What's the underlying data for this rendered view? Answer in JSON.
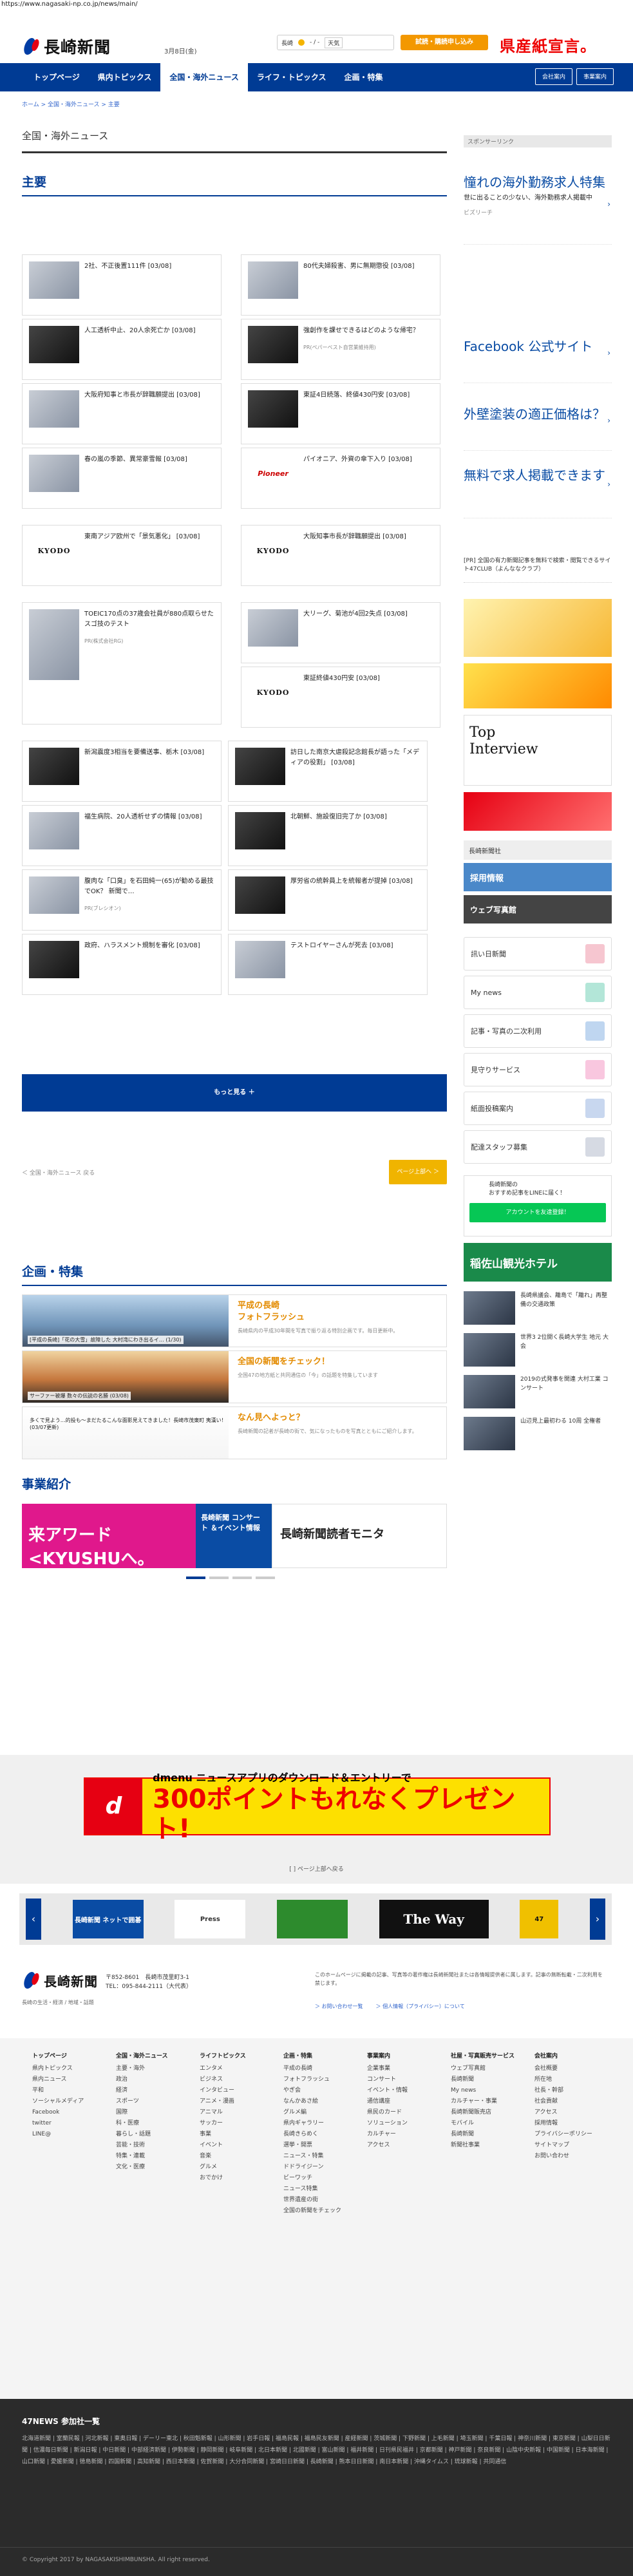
{
  "url": "https://www.nagasaki-np.co.jp/news/main/",
  "header": {
    "logo_text": "長崎新聞",
    "date": "3月8日(金)",
    "weather_label": "長崎",
    "weather_temp": "- / -",
    "weather_link": "天気",
    "trial_button": "試読・購読申し込み",
    "banner_text": "県産紙宣言。"
  },
  "nav": {
    "items": [
      "トップページ",
      "県内トピックス",
      "全国・海外ニュース",
      "ライフ・トピックス",
      "企画・特集"
    ],
    "active_index": 2,
    "right": [
      "会社案内",
      "事業案内"
    ]
  },
  "breadcrumb": "ホーム > 全国・海外ニュース > 主要",
  "page_title": "全国・海外ニュース",
  "section_main": "主要",
  "cards": [
    {
      "text": "2社、不正後置111件 [03/08]",
      "thumb": "light"
    },
    {
      "text": "80代夫婦殺害、男に無期懲役 [03/08]",
      "thumb": "light"
    },
    {
      "text": "人工透析中止、20人余死亡か [03/08]",
      "thumb": "dark"
    },
    {
      "text": "強創作を課せできるはどのような帰宅？",
      "pr": "PR(ペパーベスト自営業維持用)",
      "thumb": "dark"
    },
    {
      "text": "大阪府知事と市長が辞職願提出 [03/08]",
      "thumb": "light"
    },
    {
      "text": "東証4日続落、終値430円安 [03/08]",
      "thumb": "dark"
    },
    {
      "text": "春の嵐の季節、異常豪雪報 [03/08]",
      "thumb": "light"
    },
    {
      "text": "パイオニア、外資の傘下入り [03/08]",
      "thumb": "pioneer",
      "thumb_text": "Pioneer"
    },
    {
      "text": "東南アジア欧州で「景気悪化」 [03/08]",
      "thumb": "kyodo",
      "thumb_text": "KYODO"
    },
    {
      "text": "大阪知事市長が辞職願提出 [03/08]",
      "thumb": "kyodo",
      "thumb_text": "KYODO"
    },
    {
      "text": "TOEIC170点の37歳会社員が880点取らせたスゴ技のテスト",
      "pr": "PR(株式会社RG)",
      "thumb": "light"
    },
    {
      "text": "大リーグ、菊池が4回2失点 [03/08]",
      "thumb": "light"
    },
    {
      "text": "東証終値430円安 [03/08]",
      "thumb": "kyodo",
      "thumb_text": "KYODO"
    },
    {
      "text": "新潟震度3相当を要備送事、栃木 [03/08]",
      "thumb": "dark"
    },
    {
      "text": "訪日した南京大虐殺記念館長が語った「メディアの役割」 [03/08]",
      "thumb": "dark"
    },
    {
      "text": "福生病院、20人透析せずの情報 [03/08]",
      "thumb": "light"
    },
    {
      "text": "北朝鮮、施設復旧完了か [03/08]",
      "thumb": "dark"
    },
    {
      "text": "腹肉な「口臭」を石田純一(65)が勧める最技でOK？ 新聞で…",
      "pr": "PR(ブレシオン)",
      "thumb": "light"
    },
    {
      "text": "厚労省の統幹員上を統報者が提掉 [03/08]",
      "thumb": "dark"
    },
    {
      "text": "政府、ハラスメント規制を審化 [03/08]",
      "thumb": "dark"
    },
    {
      "text": "テストロイヤーさんが死去 [03/08]",
      "thumb": "light"
    }
  ],
  "more_button": "もっと見る ＋",
  "pager_prev": "＜ 全国・海外ニュース 戻る",
  "page_top": "ページ上部へ ＞",
  "section_feature": "企画・特集",
  "features": [
    {
      "title": "平成の長崎\nフォトフラッシュ",
      "desc": "長崎県内の平成30年間を写真で振り返る特別企画です。毎日更新中。",
      "caption": "[平成の長崎]「花の大雪」故障した 大村湾にわき出るイ… (1/30)"
    },
    {
      "title": "全国の新聞をチェック！",
      "desc": "全国47の地方紙と共同通信の「今」の話題を特集しています",
      "caption": "サーファー被爆 数々の伝説の名勝 (03/08)"
    },
    {
      "title": "なん見へよっと？",
      "desc": "長崎新聞の記者が長崎の街で、気になったものを写真とともにご紹介します。",
      "caption": "多くで見よう…的投も〜まだたるこんな面影見えてきました！長崎市茂東町 夷漢い！(03/07更新)"
    }
  ],
  "section_business": "事業紹介",
  "business": [
    "来アワード <KYUSHUへ。",
    "長崎新聞 コンサート ＆イベント情報",
    "長崎新聞読者モニタ"
  ],
  "sidebar": {
    "sponsor_label": "スポンサーリンク",
    "ads": [
      {
        "title": "憧れの海外勤務求人特集",
        "desc": "世に出ることの少ない、海外勤務求人掲載中",
        "source": "ビズリーチ"
      },
      {
        "title": "Facebook 公式サイト"
      },
      {
        "title": "外壁塗装の適正価格は？"
      },
      {
        "title": "無料で求人掲載できます"
      }
    ],
    "pr_text": "[PR] 全国の有力新聞記事を無料で検索・閲覧できるサイト47CLUB（よんななクラブ）",
    "buttons": [
      "長崎新聞社",
      "採用情報",
      "ウェブ写真館"
    ],
    "services": [
      "訊い日新聞",
      "My news",
      "記事・写真の二次利用",
      "見守りサービス",
      "紙面投稿案内",
      "配達スタッフ募集"
    ],
    "line_text": "長崎新聞の\nおすすめ記事をLINEに届く！",
    "line_button": "アカウントを友達登録！",
    "hotel_text": "稲佐山観光ホテル",
    "side_news": [
      "長崎県議会、離島で「離れ」再整備の交通政策",
      "世界3 2位開く長崎大学生 地元 大会",
      "2019の式発事を関連 大村工業 コンサート",
      "山辺見上最初わる 10周 全権者"
    ]
  },
  "footer": {
    "dmenu_logo": "d",
    "dmenu_line1": "dmenu ニュースアプリのダウンロード＆エントリーで",
    "dmenu_line2": "300ポイントもれなくプレゼント!",
    "pr_back": "[ ] ページ上部へ戻る",
    "ads": [
      "長崎新聞 ネットで囲碁",
      "Press",
      "",
      "The Way",
      "47"
    ],
    "logo_text": "長崎新聞",
    "address": "〒852-8601　長崎市茂里町3-1\nTEL：095-844-2111（大代表）",
    "sub": "長崎の生活・経済 / 地域・話題",
    "note": "このホームページに掲載の記事、写真等の著作権は長崎新聞社または各情報提供者に属します。記事の無断転載・二次利用を禁じます。",
    "links": [
      "＞ お問い合わせ一覧",
      "＞ 個人情報（プライバシー）について"
    ],
    "columns": [
      {
        "head": "トップページ",
        "items": [
          "県内トピックス",
          "県内ニュース",
          "平和",
          "ソーシャルメディア",
          "Facebook",
          "twitter",
          "LINE@"
        ]
      },
      {
        "head": "全国・海外ニュース",
        "items": [
          "主要・海外",
          "政治",
          "経済",
          "スポーツ",
          "国際",
          "科・医療",
          "暮らし・話題",
          "芸能・技術",
          "特集・連載",
          "文化・医療"
        ]
      },
      {
        "head": "ライフトピックス",
        "items": [
          "エンタメ",
          "ビジネス",
          "インタビュー",
          "アニメ・漫画",
          "アニマル",
          "サッカー",
          "事業",
          "イベント",
          "音楽",
          "グルメ",
          "おでかけ"
        ]
      },
      {
        "head": "企画・特集",
        "items": [
          "平成の長崎",
          "フォトフラッシュ",
          "やぎ会",
          "なんかあさ絵",
          "グルメ編",
          "県内ギャラリー",
          "長崎きらめく",
          "選挙・開票",
          "ニュース・特集",
          "ドドライジーン",
          "ビーワッチ",
          "ニュース特集",
          "世界遺産の街",
          "全国の新聞をチェック"
        ]
      },
      {
        "head": "事業案内",
        "items": [
          "企業事業",
          "コンサート",
          "イベント・情報",
          "通信講座",
          "県民のカード",
          "ソリューション",
          "カルチャー",
          "アクセス"
        ]
      },
      {
        "head": "社屋・写真販売サービス",
        "items": [
          "ウェブ写真館",
          "長崎新聞",
          "My news",
          "カルチャー・事業",
          "長崎新聞販売店",
          "モバイル",
          "長崎新聞",
          "新聞社事業"
        ]
      },
      {
        "head": "会社案内",
        "items": [
          "会社概要",
          "所在地",
          "社長・幹部",
          "社会貢献",
          "アクセス",
          "採用情報",
          "プライバシーポリシー",
          "サイトマップ",
          "お問い合わせ"
        ]
      }
    ],
    "n47_title": "47NEWS 参加社一覧",
    "papers": "北海道新聞 | 室蘭民報 | 河北新報 | 東奥日報 | デーリー東北 | 秋田魁新報 | 山形新聞 | 岩手日報 | 福島民報 | 福島民友新聞 | 産経新聞 | 茨城新聞 | 下野新聞 | 上毛新聞 | 埼玉新聞 | 千葉日報 | 神奈川新聞 | 東京新聞 | 山梨日日新聞 | 信濃毎日新聞 | 新潟日報 | 中日新聞 | 中部経済新聞 | 伊勢新聞 | 静岡新聞 | 岐阜新聞 | 北日本新聞 | 北國新聞 | 富山新聞 | 福井新聞 | 日刊県民福井 | 京都新聞 | 神戸新聞 | 奈良新聞 | 山陰中央新報 | 中国新聞 | 日本海新聞 | 山口新聞 | 愛媛新聞 | 徳島新聞 | 四国新聞 | 高知新聞 | 西日本新聞 | 佐賀新聞 | 大分合同新聞 | 宮崎日日新聞 | 長崎新聞 | 熊本日日新聞 | 南日本新聞 | 沖縄タイムス | 琉球新報 | 共同通信",
    "copyright": "© Copyright 2017 by NAGASAKISHIMBUNSHA. All right reserved."
  }
}
